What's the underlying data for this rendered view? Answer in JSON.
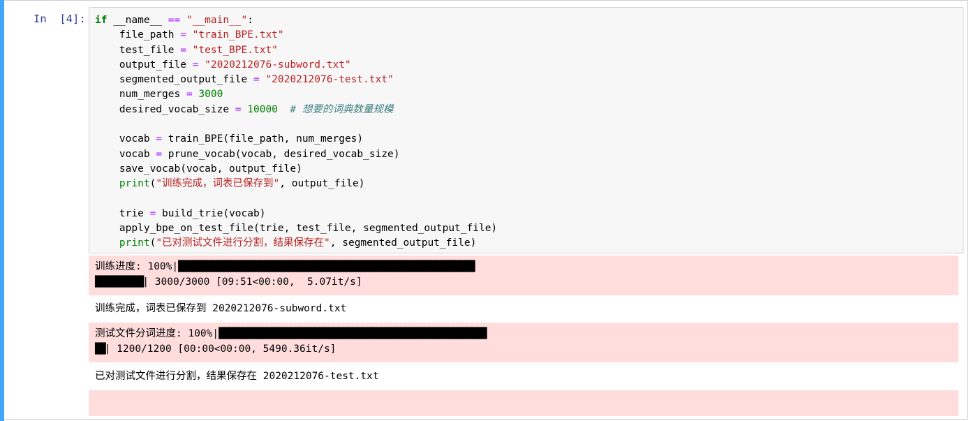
{
  "cell": {
    "prompt": "In  [4]:",
    "code": {
      "l1_kw": "if",
      "l1_a": " __name__ ",
      "l1_op": "==",
      "l1_sp": " ",
      "l1_str": "\"__main__\"",
      "l1_end": ":",
      "l2_a": "    file_path ",
      "l2_op": "=",
      "l2_str": " \"train_BPE.txt\"",
      "l3_a": "    test_file ",
      "l3_op": "=",
      "l3_str": " \"test_BPE.txt\"",
      "l4_a": "    output_file ",
      "l4_op": "=",
      "l4_str": " \"2020212076-subword.txt\"",
      "l5_a": "    segmented_output_file ",
      "l5_op": "=",
      "l5_str": " \"2020212076-test.txt\"",
      "l6_a": "    num_merges ",
      "l6_op": "=",
      "l6_num": " 3000",
      "l7_a": "    desired_vocab_size ",
      "l7_op": "=",
      "l7_num": " 10000",
      "l7_cm": "  # 想要的词典数量规模",
      "l9_a": "    vocab ",
      "l9_op": "=",
      "l9_b": " train_BPE(file_path, num_merges)",
      "l10_a": "    vocab ",
      "l10_op": "=",
      "l10_b": " prune_vocab(vocab, desired_vocab_size)",
      "l11": "    save_vocab(vocab, output_file)",
      "l12_pre": "    ",
      "l12_bi": "print",
      "l12_p": "(",
      "l12_str": "\"训练完成，词表已保存到\"",
      "l12_end": ", output_file)",
      "l14_a": "    trie ",
      "l14_op": "=",
      "l14_b": " build_trie(vocab)",
      "l15": "    apply_bpe_on_test_file(trie, test_file, segmented_output_file)",
      "l16_pre": "    ",
      "l16_bi": "print",
      "l16_p": "(",
      "l16_str": "\"已对测试文件进行分割，结果保存在\"",
      "l16_end": ", segmented_output_file)"
    }
  },
  "outputs": {
    "progress1_label": "训练进度: 100%|",
    "progress1_bar_a": "██████████████████████████████████████████████████████████████",
    "progress1_bar_b": "██████████",
    "progress1_stats": "| 3000/3000 [09:51<00:00,  5.07it/s]",
    "stdout1": "训练完成，词表已保存到 2020212076-subword.txt",
    "progress2_label": "测试文件分词进度: 100%|",
    "progress2_bar_a": "████████████████████████████████████████████████████████",
    "progress2_bar_b": "██",
    "progress2_stats": "| 1200/1200 [00:00<00:00, 5490.36it/s]",
    "stdout2": "已对测试文件进行分割，结果保存在 2020212076-test.txt",
    "progress1_fraction": 1.0,
    "progress2_fraction": 1.0
  },
  "colors": {
    "selection_bar": "#42a5f5",
    "prompt": "#303f9f",
    "stderr_bg": "#ffdddd",
    "input_bg": "#f7f7f7"
  }
}
